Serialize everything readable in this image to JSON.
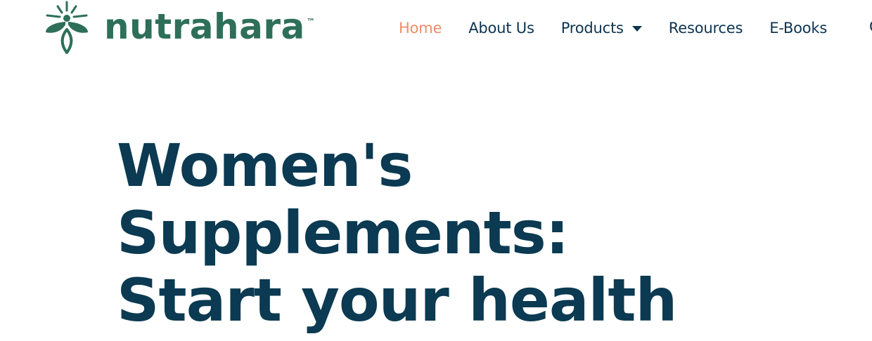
{
  "brand": {
    "name": "nutrahara",
    "trademark": "™",
    "color": "#2e6f5a",
    "icon": "herb-sprout-icon"
  },
  "nav": {
    "items": [
      {
        "label": "Home",
        "active": true
      },
      {
        "label": "About Us",
        "active": false
      },
      {
        "label": "Products",
        "active": false,
        "dropdown": true
      },
      {
        "label": "Resources",
        "active": false
      },
      {
        "label": "E-Books",
        "active": false
      }
    ],
    "truncated_item": "C",
    "active_color": "#ef8d68",
    "text_color": "#0d3450"
  },
  "hero": {
    "title_lines": [
      "Women's",
      "Supplements:",
      "Start your health"
    ],
    "color": "#0b3a52"
  }
}
